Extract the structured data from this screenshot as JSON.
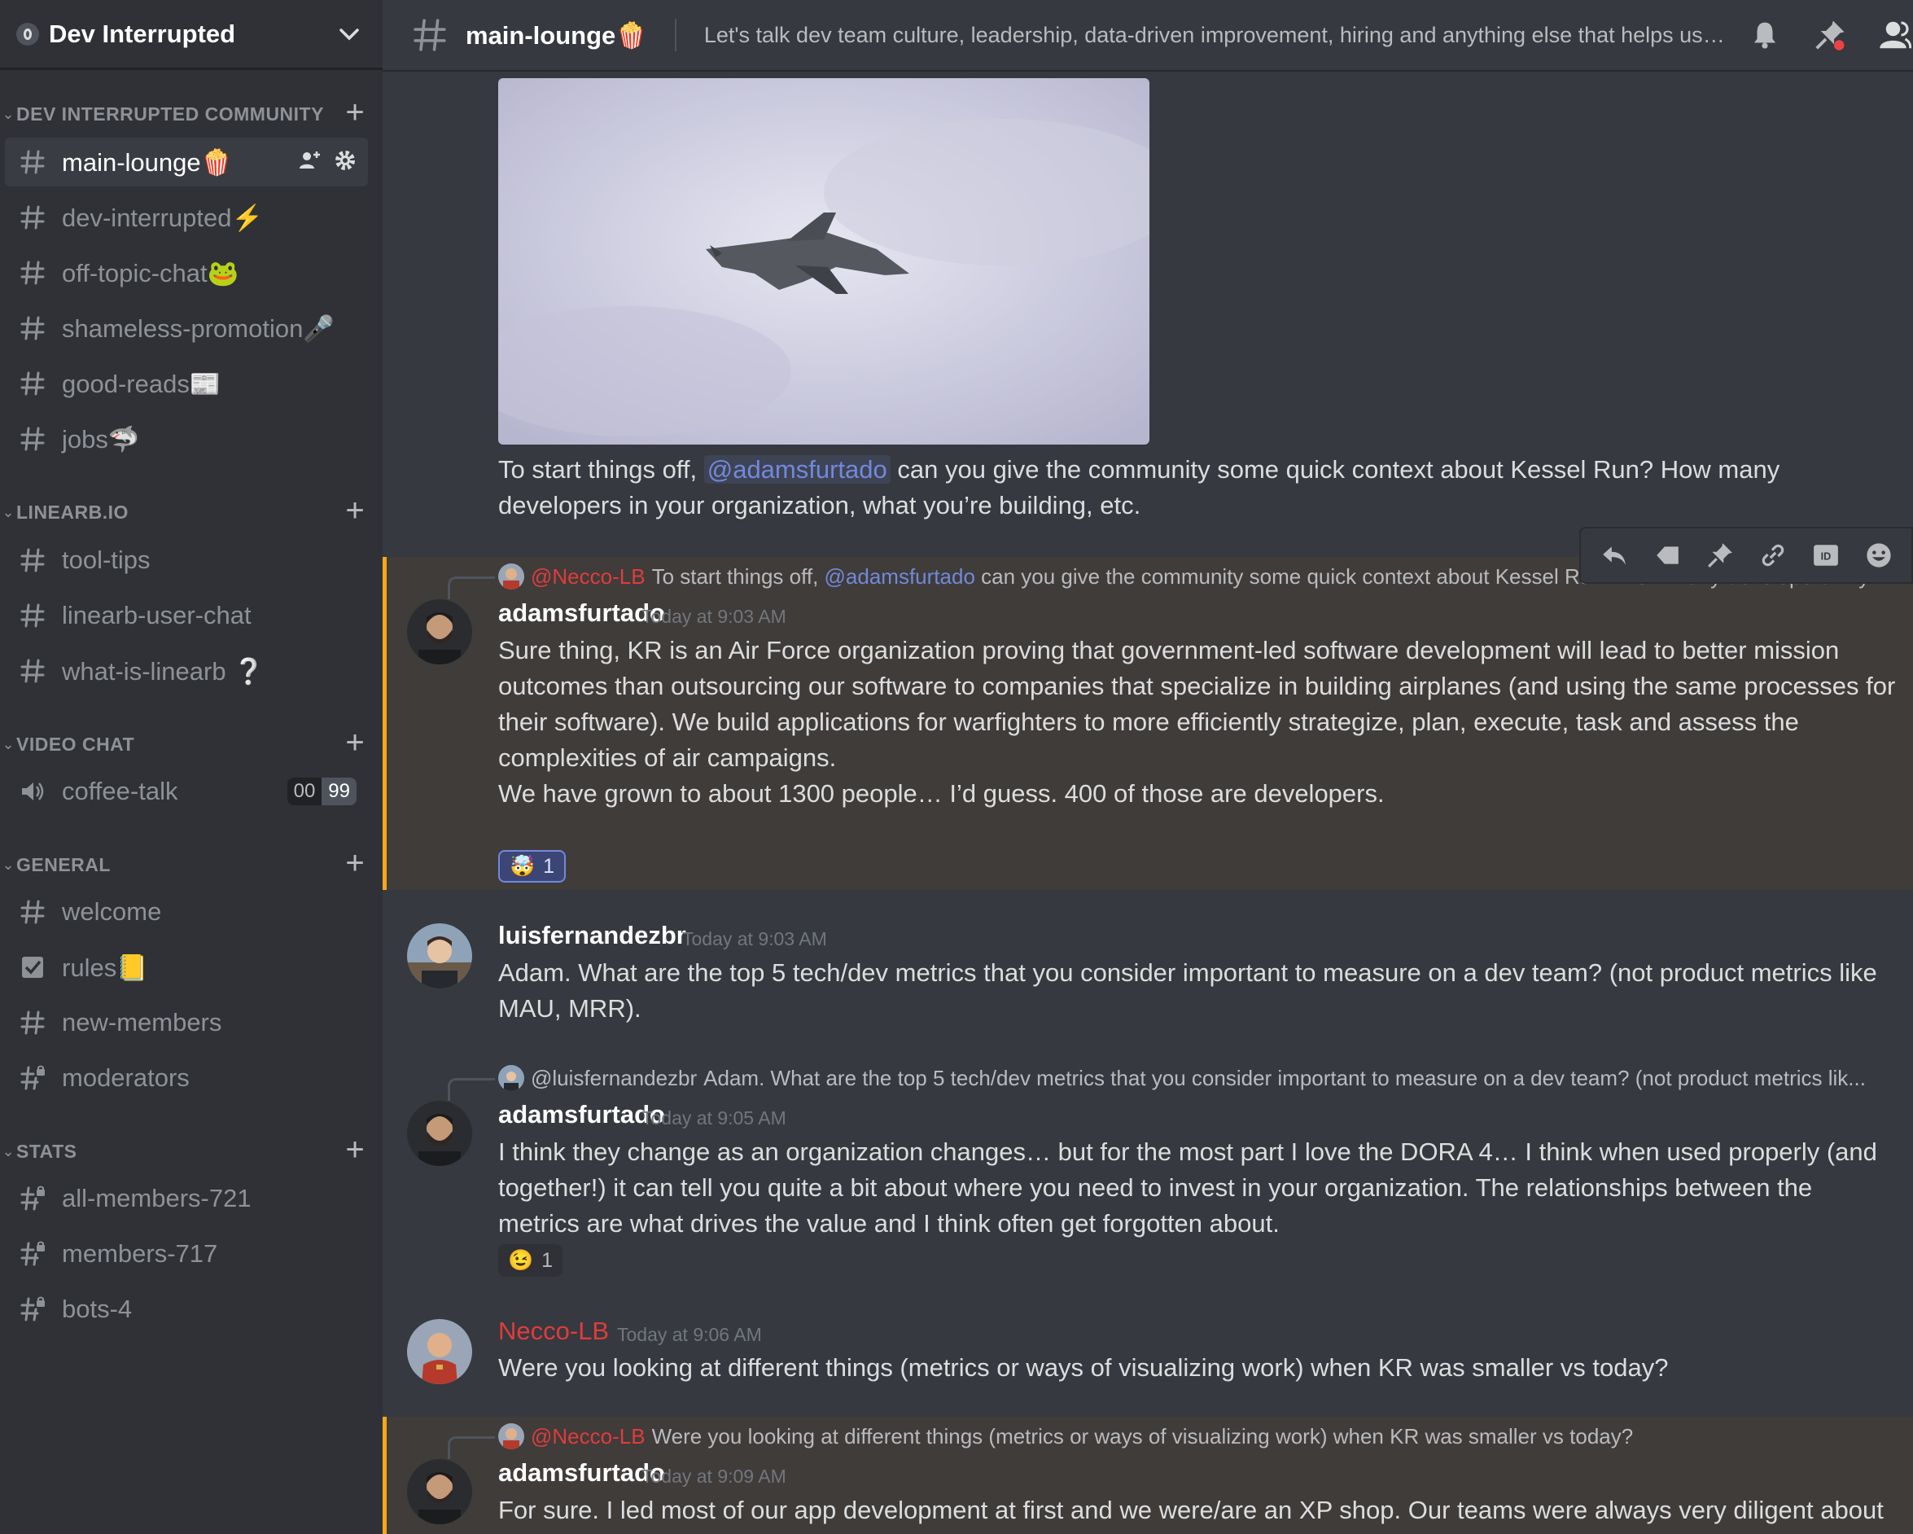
{
  "server": {
    "name": "Dev Interrupted",
    "icon": "chevron-down-icon"
  },
  "sidebar": {
    "categories": [
      {
        "label": "DEV INTERRUPTED COMMUNITY"
      },
      {
        "label": "LINEARB.IO"
      },
      {
        "label": "VIDEO CHAT"
      },
      {
        "label": "GENERAL"
      },
      {
        "label": "STATS"
      }
    ],
    "channels": [
      {
        "label": "main-lounge🍿",
        "icon": "hash-icon"
      },
      {
        "label": "dev-interrupted⚡",
        "icon": "hash-icon"
      },
      {
        "label": "off-topic-chat🐸",
        "icon": "hash-icon"
      },
      {
        "label": "shameless-promotion🎤",
        "icon": "hash-icon"
      },
      {
        "label": "good-reads📰",
        "icon": "hash-icon"
      },
      {
        "label": "jobs🦈",
        "icon": "hash-icon"
      },
      {
        "label": "tool-tips",
        "icon": "hash-icon"
      },
      {
        "label": "linearb-user-chat",
        "icon": "hash-icon"
      },
      {
        "label": "what-is-linearb ❔",
        "icon": "hash-icon"
      },
      {
        "label": "coffee-talk",
        "icon": "speaker-icon",
        "count_a": "00",
        "count_b": "99"
      },
      {
        "label": "welcome",
        "icon": "hash-icon"
      },
      {
        "label": "rules📒",
        "icon": "checkbox-icon"
      },
      {
        "label": "new-members",
        "icon": "hash-icon"
      },
      {
        "label": "moderators",
        "icon": "locked-hash-icon"
      },
      {
        "label": "all-members-721",
        "icon": "locked-hash-icon"
      },
      {
        "label": "members-717",
        "icon": "locked-hash-icon"
      },
      {
        "label": "bots-4",
        "icon": "locked-hash-icon"
      }
    ]
  },
  "header": {
    "channel_name": "main-lounge🍿",
    "topic": "Let's talk dev team culture, leadership, data-driven improvement, hiring and anything else that helps us imp..."
  },
  "messages": {
    "m0": {
      "text_before": "To start things off, ",
      "mention": "@adamsfurtado",
      "text_after": " can you give the community some quick context about Kessel Run? How many developers in your organization, what you’re building, etc."
    },
    "m1": {
      "reply_name": "@Necco-LB",
      "reply_text_before": "To start things off, ",
      "reply_mention": "@adamsfurtado",
      "reply_text_after": " can you give the community some quick context about Kessel Run? How many developers in your organization, what you’re building, etc.",
      "author": "adamsfurtado",
      "time": "Today at 9:03 AM",
      "para1": "Sure thing, KR is an Air Force organization proving that government-led software development will lead to better mission outcomes than outsourcing our software to companies that specialize in building airplanes (and using the same processes for their software).   We build applications for warfighters to more efficiently strategize, plan, execute, task and assess the complexities of air campaigns.",
      "para2": "We have grown to about 1300 people… I’d guess. 400 of those are developers.",
      "reaction_emoji": "🤯",
      "reaction_count": "1"
    },
    "m2": {
      "author": "luisfernandezbr",
      "time": "Today at 9:03 AM",
      "text": "Adam. What are the top 5 tech/dev metrics that you consider important to measure on a dev team? (not product metrics like MAU, MRR)."
    },
    "m3": {
      "reply_name": "@luisfernandezbr",
      "reply_text": "Adam. What are the top 5 tech/dev metrics that you consider important to measure on a dev team? (not product metrics lik...",
      "author": "adamsfurtado",
      "time": "Today at 9:05 AM",
      "text": "I think they change as an organization changes… but for the most part I love the DORA 4… I think when used properly (and together!) it can tell you quite a bit about where you need to invest in your organization.  The relationships between the metrics are what drives the value and I think often get forgotten about.",
      "reaction_emoji": "😉",
      "reaction_count": "1"
    },
    "m4": {
      "author": "Necco-LB",
      "time": "Today at 9:06 AM",
      "text": "Were you looking at different things (metrics or ways of visualizing work) when KR was smaller vs today?"
    },
    "m5": {
      "reply_name": "@Necco-LB",
      "reply_text": "Were you looking at different things (metrics or ways of visualizing work) when KR was smaller vs today?",
      "author": "adamsfurtado",
      "time": "Today at 9:09 AM",
      "text": "For sure. I led most of our app development at first and we were/are an XP shop.  Our teams were always very diligent about"
    }
  },
  "colors": {
    "accent": "#7289da",
    "highlight_border": "#faa61a",
    "highlight_bg": "#3f3c3a",
    "necco": "#e03c3c",
    "sidebar": "#2f3136",
    "main": "#36393f"
  }
}
